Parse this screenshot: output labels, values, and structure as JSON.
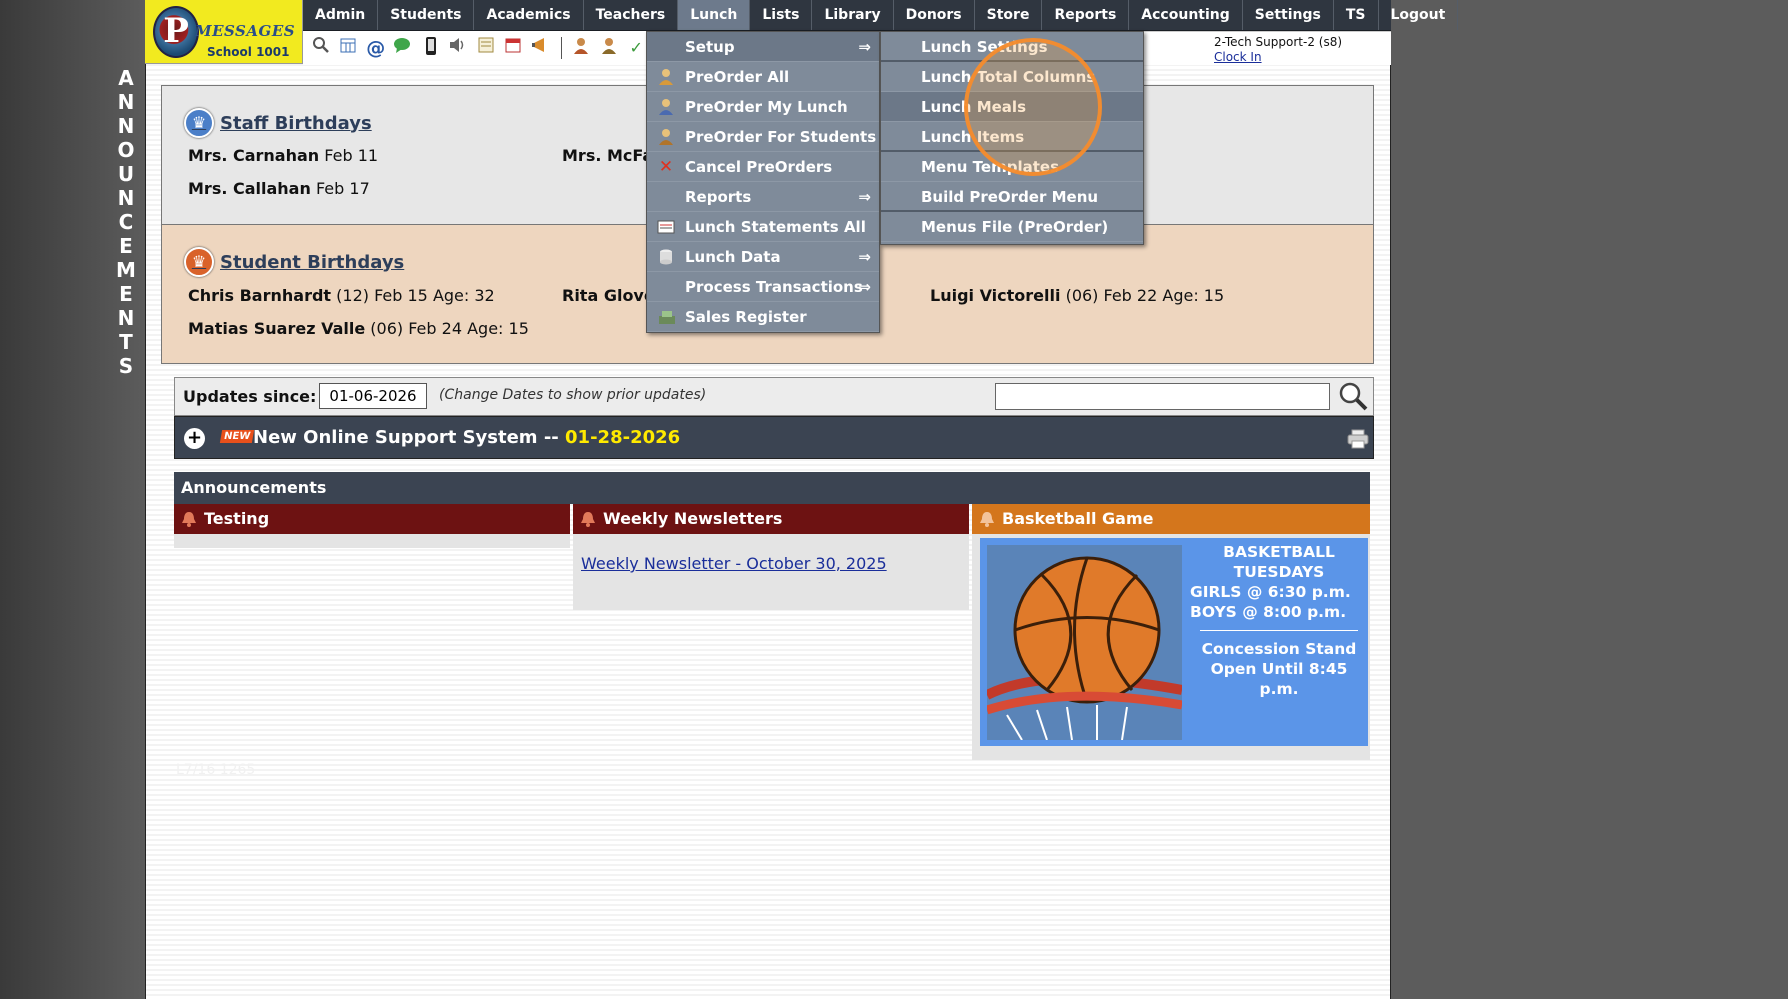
{
  "logo": {
    "letter": "P",
    "word": "MESSAGES",
    "school": "School 1001"
  },
  "side_word": [
    "A",
    "N",
    "N",
    "O",
    "U",
    "N",
    "C",
    "E",
    "M",
    "E",
    "N",
    "T",
    "S"
  ],
  "nav": [
    "Admin",
    "Students",
    "Academics",
    "Teachers",
    "Lunch",
    "Lists",
    "Library",
    "Donors",
    "Store",
    "Reports",
    "Accounting",
    "Settings",
    "TS",
    "Logout"
  ],
  "nav_active": "Lunch",
  "toolbar_icons": [
    "search-icon",
    "calendar-grid-icon",
    "at-sign-icon",
    "chat-icon",
    "phone-icon",
    "speaker-icon",
    "form-icon",
    "calendar-icon",
    "megaphone-icon",
    "person-add-icon",
    "person-icon",
    "check-icon"
  ],
  "user": {
    "name": "2-Tech Support-2 (s8)",
    "clock_in": "Clock In"
  },
  "staff": {
    "title": "Staff Birthdays",
    "entries": [
      {
        "name": "Mrs. Carnahan",
        "date": "Feb 11"
      },
      {
        "name": "Mrs. McFa",
        "date": ""
      },
      {
        "name": "Mrs. Callahan",
        "date": "Feb 17"
      }
    ]
  },
  "students": {
    "title": " Student Birthdays",
    "entries": [
      {
        "name": "Chris Barnhardt",
        "info": "(12) Feb 15 Age: 32"
      },
      {
        "name": "Rita Glove",
        "info": ""
      },
      {
        "name": "Luigi Victorelli",
        "info": "(06) Feb 22 Age: 15"
      },
      {
        "name": "Matias Suarez Valle",
        "info": "(06) Feb 24 Age: 15"
      }
    ]
  },
  "updates": {
    "label": "Updates since:",
    "date": "01-06-2026",
    "hint": "(Change Dates to show prior updates)",
    "search_placeholder": ""
  },
  "news": {
    "badge": "NEW",
    "title": "New Online Support System -- ",
    "date": "01-28-2026"
  },
  "announcements": {
    "header": "Announcements",
    "cols": [
      {
        "title": "Testing"
      },
      {
        "title": "Weekly Newsletters",
        "link": "Weekly Newsletter - October 30, 2025"
      },
      {
        "title": "Basketball Game"
      }
    ],
    "basketball": {
      "l1": "BASKETBALL",
      "l2": "TUESDAYS",
      "l3": "GIRLS @ 6:30 p.m.",
      "l4": "BOYS  @ 8:00 p.m.",
      "l5": "Concession Stand",
      "l6": "Open Until 8:45 p.m."
    }
  },
  "faint_text": "L7/16 1265",
  "lunch_menu": [
    {
      "label": "Setup",
      "arrow": "⇒",
      "icon": ""
    },
    {
      "label": "PreOrder All",
      "arrow": "",
      "icon": "person-icon"
    },
    {
      "label": "PreOrder My Lunch",
      "arrow": "",
      "icon": "person-icon"
    },
    {
      "label": "PreOrder For Students",
      "arrow": "",
      "icon": "person-icon"
    },
    {
      "label": "Cancel PreOrders",
      "arrow": "",
      "icon": "x-icon"
    },
    {
      "label": "Reports",
      "arrow": "⇒",
      "icon": ""
    },
    {
      "label": "Lunch Statements All",
      "arrow": "",
      "icon": "statement-icon"
    },
    {
      "label": "Lunch Data",
      "arrow": "⇒",
      "icon": "database-icon"
    },
    {
      "label": "Process Transactions",
      "arrow": "⇒",
      "icon": ""
    },
    {
      "label": "Sales Register",
      "arrow": "",
      "icon": "register-icon"
    }
  ],
  "setup_submenu": [
    "Lunch Settings",
    "Lunch Total Columns",
    "Lunch Meals",
    "Lunch Items",
    "Menu Templates",
    "Build PreOrder Menu",
    "Menus File (PreOrder)"
  ],
  "colors": {
    "nav_bg": "#2f3640",
    "menu_bg": "#7f8b9a",
    "accent_yellow": "#ffea00",
    "click_ring": "#f58c2d"
  }
}
